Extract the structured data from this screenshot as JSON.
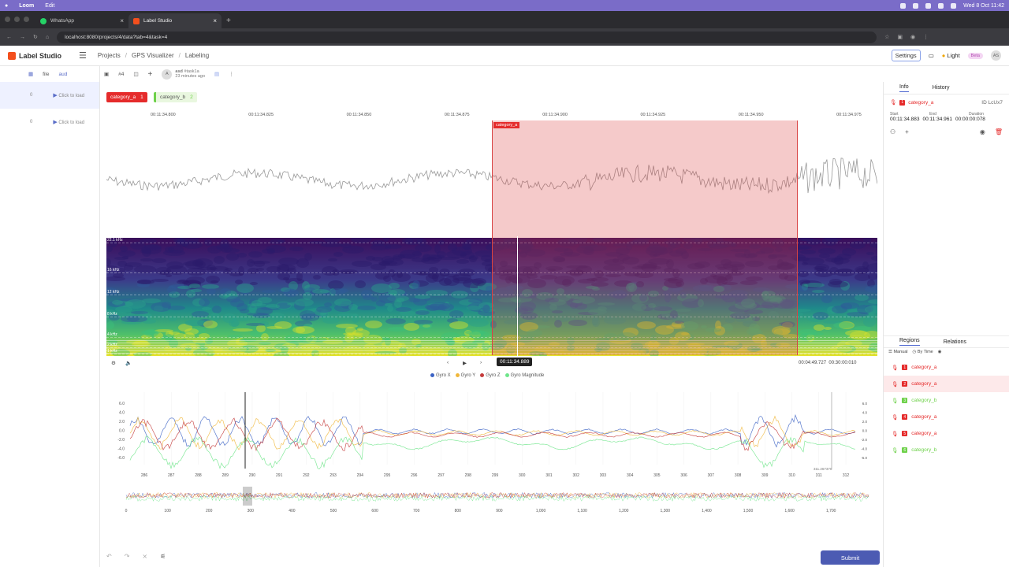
{
  "menubar": {
    "app": "Loom",
    "edit": "Edit",
    "clock": "Wed 8 Oct 11:42"
  },
  "browser": {
    "tabs": [
      {
        "label": "WhatsApp",
        "color": "#25d366"
      },
      {
        "label": "Label Studio",
        "color": "#f34f1d"
      }
    ],
    "url": "localhost:8080/projects/4/data?tab=4&task=4"
  },
  "app": {
    "logo": "Label Studio",
    "breadcrumbs": [
      "Projects",
      "GPS Visualizer",
      "Labeling"
    ],
    "settings": "Settings",
    "theme": "Light",
    "beta": "Beta",
    "avatar": "AS"
  },
  "tasks_sidebar": {
    "tools": [
      "file",
      "aud"
    ],
    "rows": [
      {
        "id": "0",
        "action": "Click to load"
      },
      {
        "id": "0",
        "action": "Click to load"
      }
    ]
  },
  "annotation_bar": {
    "task": "#4",
    "user": "asd",
    "task_ref": "#task1a",
    "time": "23 minutes ago"
  },
  "labels": [
    {
      "name": "category_a",
      "hotkey": "1",
      "color": "#e52b2b"
    },
    {
      "name": "category_b",
      "hotkey": "2",
      "color": "#6ed14a"
    }
  ],
  "audio": {
    "ticks": [
      "00:11:34.800",
      "00:11:34.825",
      "00:11:34.850",
      "00:11:34.875",
      "00:11:34.900",
      "00:11:34.925",
      "00:11:34.950",
      "00:11:34.975"
    ],
    "freq_labels": [
      "22.1 kHz",
      "16 kHz",
      "12 kHz",
      "8 kHz",
      "4 kHz",
      "2 kHz",
      "1 kHz"
    ],
    "region_label": "category_a",
    "cursor_time": "00:11:34.889",
    "current": "00:04:49.727",
    "duration": "00:30:00:010"
  },
  "info_panel": {
    "tabs": [
      "Info",
      "History"
    ],
    "region": "category_a",
    "id": "ID LcUx7",
    "start_label": "Start",
    "start": "00:11:34.883",
    "end_label": "End",
    "end": "00:11:34.961",
    "duration_label": "Duration",
    "duration": "00:00:00:078"
  },
  "regions_panel": {
    "tabs": [
      "Regions",
      "Relations"
    ],
    "sort": [
      "Manual",
      "By Time"
    ],
    "rows": [
      {
        "label": "category_a",
        "n": "1",
        "color": "#e52b2b"
      },
      {
        "label": "category_a",
        "n": "2",
        "color": "#e52b2b"
      },
      {
        "label": "category_b",
        "n": "3",
        "color": "#6ed14a"
      },
      {
        "label": "category_a",
        "n": "4",
        "color": "#e52b2b"
      },
      {
        "label": "category_a",
        "n": "5",
        "color": "#e52b2b"
      },
      {
        "label": "category_b",
        "n": "6",
        "color": "#6ed14a"
      }
    ]
  },
  "gyro": {
    "legend": [
      {
        "name": "Gyro X",
        "color": "#3b62c4"
      },
      {
        "name": "Gyro Y",
        "color": "#f0b73a"
      },
      {
        "name": "Gyro Z",
        "color": "#c43b3b"
      },
      {
        "name": "Gyro Magnitude",
        "color": "#6ee58a"
      }
    ],
    "yticks": [
      "6.0",
      "4.0",
      "2.0",
      "0.0",
      "-2.0",
      "-4.0",
      "-6.0"
    ],
    "xticks": [
      "286",
      "287",
      "288",
      "289",
      "290",
      "291",
      "292",
      "293",
      "294",
      "295",
      "296",
      "297",
      "298",
      "299",
      "300",
      "301",
      "302",
      "303",
      "304",
      "305",
      "306",
      "307",
      "308",
      "309",
      "310",
      "311",
      "312"
    ],
    "mini_xticks": [
      "0",
      "100",
      "200",
      "300",
      "400",
      "500",
      "600",
      "700",
      "800",
      "900",
      "1,000",
      "1,100",
      "1,200",
      "1,300",
      "1,400",
      "1,500",
      "1,600",
      "1,700"
    ],
    "readout": "311.267378"
  },
  "submit": "Submit"
}
